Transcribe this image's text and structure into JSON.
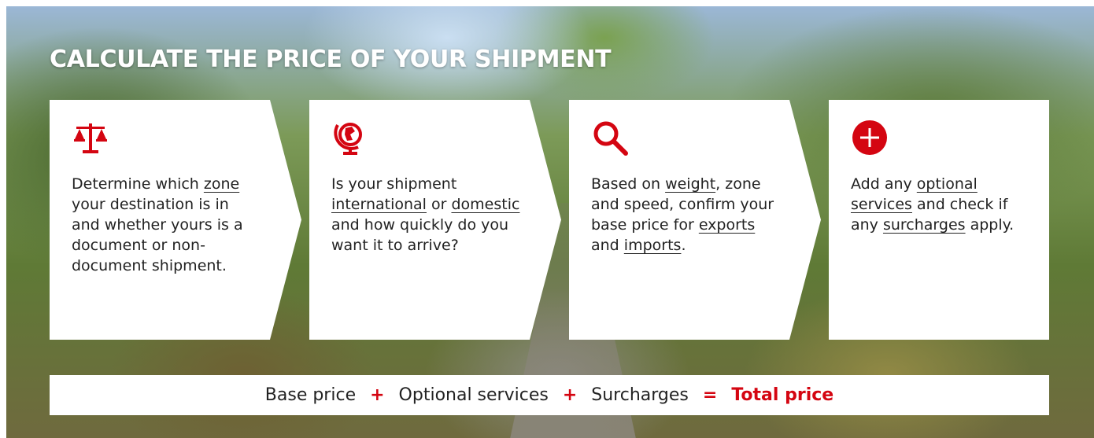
{
  "title": "CALCULATE THE PRICE OF YOUR SHIPMENT",
  "colors": {
    "accent": "#d40511",
    "card_bg": "#ffffff",
    "text": "#222222"
  },
  "steps": [
    {
      "icon": "scales-icon",
      "parts": [
        {
          "t": "Determine which "
        },
        {
          "t": "zone",
          "link": true
        },
        {
          "t": " your destination is in and whether yours is a document or non-document shipment."
        }
      ]
    },
    {
      "icon": "globe-icon",
      "parts": [
        {
          "t": "Is your shipment "
        },
        {
          "t": "international",
          "link": true
        },
        {
          "t": " or "
        },
        {
          "t": "domestic",
          "link": true
        },
        {
          "t": " and how quickly do you want it to arrive?"
        }
      ]
    },
    {
      "icon": "search-icon",
      "parts": [
        {
          "t": "Based on "
        },
        {
          "t": "weight",
          "link": true
        },
        {
          "t": ", zone and speed, confirm your base price for "
        },
        {
          "t": "exports",
          "link": true
        },
        {
          "t": " and "
        },
        {
          "t": "imports",
          "link": true
        },
        {
          "t": "."
        }
      ]
    },
    {
      "icon": "plus-circle-icon",
      "parts": [
        {
          "t": "Add any "
        },
        {
          "t": "optional services",
          "link": true
        },
        {
          "t": " and check if any "
        },
        {
          "t": "surcharges",
          "link": true
        },
        {
          "t": " apply."
        }
      ]
    }
  ],
  "formula": {
    "base": "Base price",
    "plus1": "+",
    "optional": "Optional services",
    "plus2": "+",
    "surcharges": "Surcharges",
    "equals": "=",
    "total": "Total price"
  }
}
